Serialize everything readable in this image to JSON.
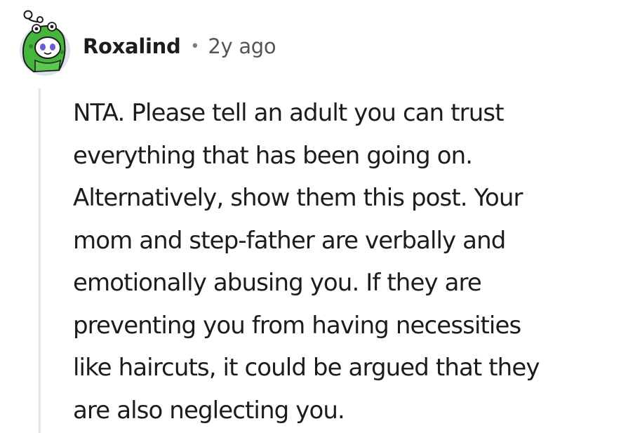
{
  "comment": {
    "author": "Roxalind",
    "separator": "•",
    "timestamp": "2y ago",
    "avatar_icon": "snoo-avatar-green-frog-hat-icon",
    "body_lines": [
      "NTA. Please tell an adult you can trust",
      "everything that has been going on.",
      "Alternatively, show them this post. Your",
      "mom and step-father are verbally and",
      "emotionally abusing you. If they are",
      "preventing you from having necessities",
      "like haircuts, it could be argued that they",
      "are also neglecting you."
    ]
  },
  "colors": {
    "text": "#1c1c1c",
    "meta": "#555555",
    "thread_line": "#e5e5e5",
    "avatar_bg": "#dce3ea",
    "hat_green": "#46b53b"
  }
}
